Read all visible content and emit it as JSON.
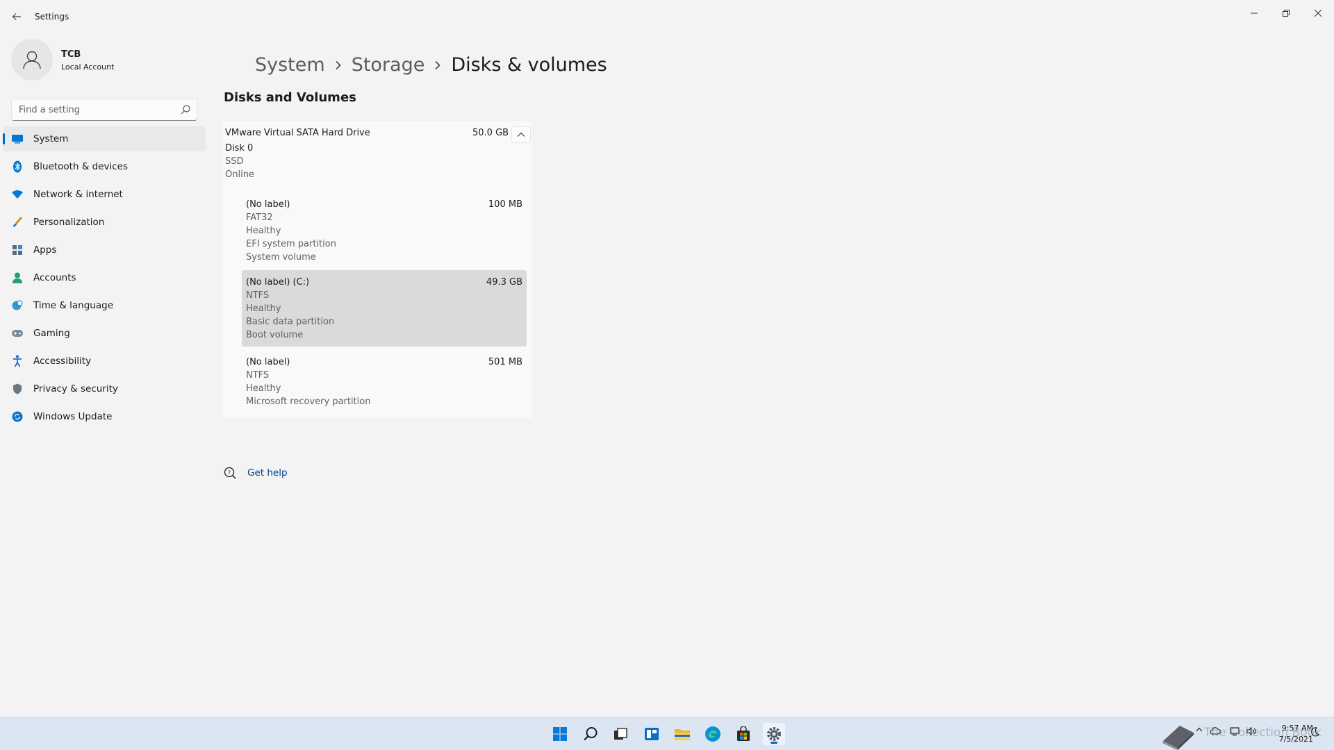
{
  "window": {
    "title": "Settings",
    "back_icon": "back-arrow-icon",
    "controls": [
      "minimize-icon",
      "restore-icon",
      "close-icon"
    ]
  },
  "profile": {
    "name": "TCB",
    "account_type": "Local Account"
  },
  "search": {
    "placeholder": "Find a setting"
  },
  "sidebar": {
    "items": [
      {
        "label": "System",
        "icon": "system-icon",
        "active": true
      },
      {
        "label": "Bluetooth & devices",
        "icon": "bluetooth-icon"
      },
      {
        "label": "Network & internet",
        "icon": "wifi-icon"
      },
      {
        "label": "Personalization",
        "icon": "brush-icon"
      },
      {
        "label": "Apps",
        "icon": "apps-icon"
      },
      {
        "label": "Accounts",
        "icon": "person-icon"
      },
      {
        "label": "Time & language",
        "icon": "globe-clock-icon"
      },
      {
        "label": "Gaming",
        "icon": "gamepad-icon"
      },
      {
        "label": "Accessibility",
        "icon": "accessibility-icon"
      },
      {
        "label": "Privacy & security",
        "icon": "shield-icon"
      },
      {
        "label": "Windows Update",
        "icon": "update-icon"
      }
    ]
  },
  "breadcrumb": {
    "items": [
      "System",
      "Storage",
      "Disks & volumes"
    ]
  },
  "main": {
    "section_title": "Disks and Volumes",
    "disk": {
      "name": "VMware Virtual SATA Hard Drive",
      "size": "50.0 GB",
      "number": "Disk 0",
      "media": "SSD",
      "status": "Online",
      "volumes": [
        {
          "label": "(No label)",
          "size": "100 MB",
          "lines": [
            "FAT32",
            "Healthy",
            "EFI system partition",
            "System volume"
          ]
        },
        {
          "label": "(No label) (C:)",
          "size": "49.3 GB",
          "lines": [
            "NTFS",
            "Healthy",
            "Basic data partition",
            "Boot volume"
          ],
          "selected": true
        },
        {
          "label": "(No label)",
          "size": "501 MB",
          "lines": [
            "NTFS",
            "Healthy",
            "Microsoft recovery partition"
          ]
        }
      ]
    }
  },
  "help": {
    "label": "Get help"
  },
  "taskbar": {
    "apps": [
      "start-icon",
      "search-icon",
      "task-view-icon",
      "widgets-icon",
      "file-explorer-icon",
      "edge-icon",
      "store-icon",
      "settings-icon"
    ],
    "clock": {
      "time": "9:57 AM",
      "date": "7/5/2021"
    },
    "watermark": "The Collection Book"
  },
  "colors": {
    "accent": "#0067c0",
    "background": "#f3f3f3",
    "taskbar": "#dce6f2",
    "link": "#003e92"
  }
}
